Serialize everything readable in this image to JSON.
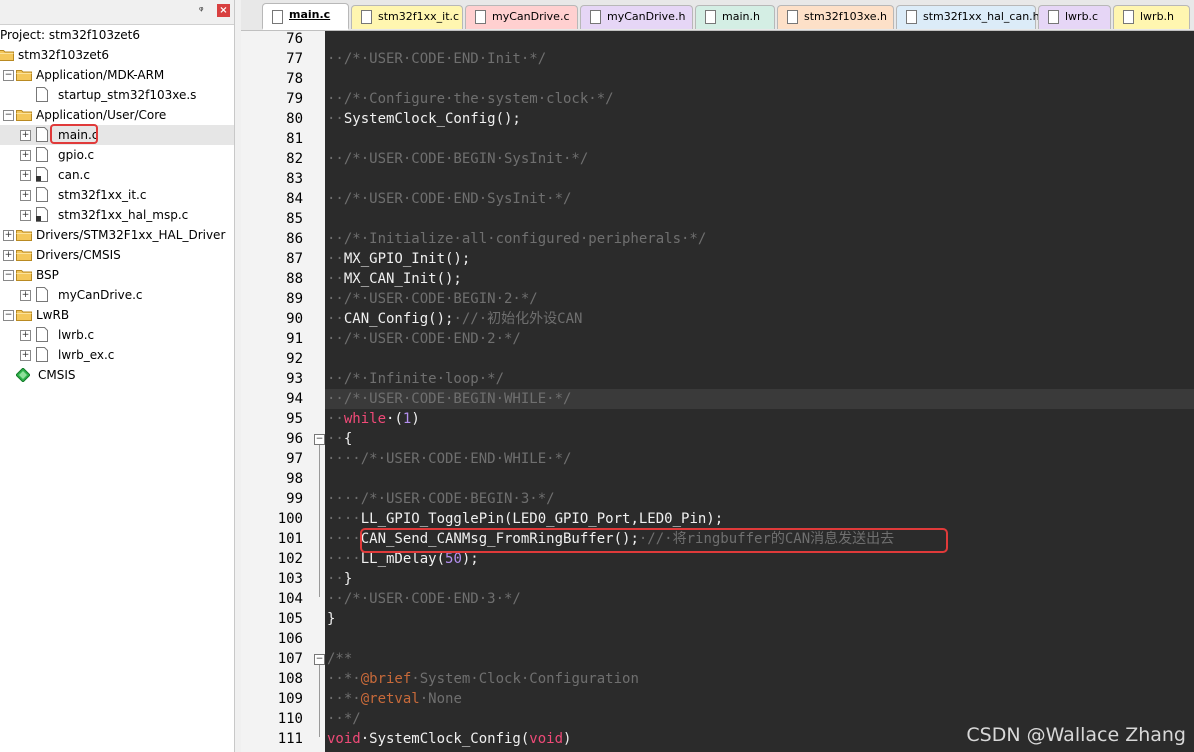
{
  "project_pane": {
    "pin_symbol": "ᵠ",
    "close_symbol": "×",
    "items": [
      {
        "label": "Project: stm32f103zet6",
        "type": "root-label",
        "level": 0
      },
      {
        "label": "stm32f103zet6",
        "type": "project",
        "level": 0
      },
      {
        "label": "Application/MDK-ARM",
        "type": "folder",
        "level": 1,
        "expander": "−"
      },
      {
        "label": "startup_stm32f103xe.s",
        "type": "file",
        "level": 2
      },
      {
        "label": "Application/User/Core",
        "type": "folder",
        "level": 1,
        "expander": "−"
      },
      {
        "label": "main.c",
        "type": "file",
        "level": 2,
        "expander": "+",
        "selected": true
      },
      {
        "label": "gpio.c",
        "type": "file",
        "level": 2,
        "expander": "+"
      },
      {
        "label": "can.c",
        "type": "file-lock",
        "level": 2,
        "expander": "+"
      },
      {
        "label": "stm32f1xx_it.c",
        "type": "file",
        "level": 2,
        "expander": "+"
      },
      {
        "label": "stm32f1xx_hal_msp.c",
        "type": "file-lock",
        "level": 2,
        "expander": "+"
      },
      {
        "label": "Drivers/STM32F1xx_HAL_Driver",
        "type": "folder",
        "level": 1,
        "expander": "+"
      },
      {
        "label": "Drivers/CMSIS",
        "type": "folder",
        "level": 1,
        "expander": "+"
      },
      {
        "label": "BSP",
        "type": "folder",
        "level": 1,
        "expander": "−"
      },
      {
        "label": "myCanDrive.c",
        "type": "file",
        "level": 2,
        "expander": "+"
      },
      {
        "label": "LwRB",
        "type": "folder",
        "level": 1,
        "expander": "−"
      },
      {
        "label": "lwrb.c",
        "type": "file",
        "level": 2,
        "expander": "+"
      },
      {
        "label": "lwrb_ex.c",
        "type": "file",
        "level": 2,
        "expander": "+"
      },
      {
        "label": "CMSIS",
        "type": "component",
        "level": 1
      }
    ]
  },
  "tabs": [
    {
      "label": "main.c",
      "color": "#ffffff",
      "active": true
    },
    {
      "label": "stm32f1xx_it.c",
      "color": "#fff6b0"
    },
    {
      "label": "myCanDrive.c",
      "color": "#ffd0d0"
    },
    {
      "label": "myCanDrive.h",
      "color": "#e6d6f6"
    },
    {
      "label": "main.h",
      "color": "#d4eee4"
    },
    {
      "label": "stm32f103xe.h",
      "color": "#fde0c8"
    },
    {
      "label": "stm32f1xx_hal_can.h",
      "color": "#dcecf8"
    },
    {
      "label": "lwrb.c",
      "color": "#e6d6f6"
    },
    {
      "label": "lwrb.h",
      "color": "#fff6b0"
    }
  ],
  "editor": {
    "lines": [
      {
        "n": "76",
        "segs": [
          [
            "code",
            ""
          ]
        ]
      },
      {
        "n": "77",
        "segs": [
          [
            "comment",
            "··/*·USER·CODE·END·Init·*/"
          ]
        ]
      },
      {
        "n": "78",
        "segs": [
          [
            "code",
            ""
          ]
        ]
      },
      {
        "n": "79",
        "segs": [
          [
            "comment",
            "··/*·Configure·the·system·clock·*/"
          ]
        ]
      },
      {
        "n": "80",
        "segs": [
          [
            "comment",
            "··"
          ],
          [
            "code",
            "SystemClock_Config();"
          ]
        ]
      },
      {
        "n": "81",
        "segs": [
          [
            "code",
            ""
          ]
        ]
      },
      {
        "n": "82",
        "segs": [
          [
            "comment",
            "··/*·USER·CODE·BEGIN·SysInit·*/"
          ]
        ]
      },
      {
        "n": "83",
        "segs": [
          [
            "code",
            ""
          ]
        ]
      },
      {
        "n": "84",
        "segs": [
          [
            "comment",
            "··/*·USER·CODE·END·SysInit·*/"
          ]
        ]
      },
      {
        "n": "85",
        "segs": [
          [
            "code",
            ""
          ]
        ]
      },
      {
        "n": "86",
        "segs": [
          [
            "comment",
            "··/*·Initialize·all·configured·peripherals·*/"
          ]
        ]
      },
      {
        "n": "87",
        "segs": [
          [
            "comment",
            "··"
          ],
          [
            "code",
            "MX_GPIO_Init();"
          ]
        ]
      },
      {
        "n": "88",
        "segs": [
          [
            "comment",
            "··"
          ],
          [
            "code",
            "MX_CAN_Init();"
          ]
        ]
      },
      {
        "n": "89",
        "segs": [
          [
            "comment",
            "··/*·USER·CODE·BEGIN·2·*/"
          ]
        ]
      },
      {
        "n": "90",
        "segs": [
          [
            "comment",
            "··"
          ],
          [
            "code",
            "CAN_Config();"
          ],
          [
            "comment",
            "·//·初始化外设CAN"
          ]
        ]
      },
      {
        "n": "91",
        "segs": [
          [
            "comment",
            "··/*·USER·CODE·END·2·*/"
          ]
        ]
      },
      {
        "n": "92",
        "segs": [
          [
            "code",
            ""
          ]
        ]
      },
      {
        "n": "93",
        "segs": [
          [
            "comment",
            "··/*·Infinite·loop·*/"
          ]
        ]
      },
      {
        "n": "94",
        "segs": [
          [
            "comment",
            "··/*·USER·CODE·BEGIN·WHILE·*/"
          ]
        ],
        "hl": true
      },
      {
        "n": "95",
        "segs": [
          [
            "comment",
            "··"
          ],
          [
            "keyword",
            "while"
          ],
          [
            "code",
            "·("
          ],
          [
            "num",
            "1"
          ],
          [
            "code",
            ")"
          ]
        ]
      },
      {
        "n": "96",
        "segs": [
          [
            "comment",
            "··"
          ],
          [
            "code",
            "{"
          ]
        ],
        "fold": "−"
      },
      {
        "n": "97",
        "segs": [
          [
            "comment",
            "····/*·USER·CODE·END·WHILE·*/"
          ]
        ]
      },
      {
        "n": "98",
        "segs": [
          [
            "code",
            ""
          ]
        ]
      },
      {
        "n": "99",
        "segs": [
          [
            "comment",
            "····/*·USER·CODE·BEGIN·3·*/"
          ]
        ]
      },
      {
        "n": "100",
        "segs": [
          [
            "comment",
            "····"
          ],
          [
            "code",
            "LL_GPIO_TogglePin(LED0_GPIO_Port,LED0_Pin);"
          ]
        ]
      },
      {
        "n": "101",
        "segs": [
          [
            "comment",
            "····"
          ],
          [
            "code",
            "CAN_Send_CANMsg_FromRingBuffer();"
          ],
          [
            "comment",
            "·//·将ringbuffer的CAN消息发送出去"
          ]
        ]
      },
      {
        "n": "102",
        "segs": [
          [
            "comment",
            "····"
          ],
          [
            "code",
            "LL_mDelay("
          ],
          [
            "num",
            "50"
          ],
          [
            "code",
            ");"
          ]
        ]
      },
      {
        "n": "103",
        "segs": [
          [
            "comment",
            "··"
          ],
          [
            "code",
            "}"
          ]
        ]
      },
      {
        "n": "104",
        "segs": [
          [
            "comment",
            "··/*·USER·CODE·END·3·*/"
          ]
        ]
      },
      {
        "n": "105",
        "segs": [
          [
            "code",
            "}"
          ]
        ]
      },
      {
        "n": "106",
        "segs": [
          [
            "code",
            ""
          ]
        ]
      },
      {
        "n": "107",
        "segs": [
          [
            "comment",
            "/**"
          ]
        ],
        "fold": "−"
      },
      {
        "n": "108",
        "segs": [
          [
            "comment",
            "··*·"
          ],
          [
            "tag",
            "@brief"
          ],
          [
            "comment",
            "·System·Clock·Configuration"
          ]
        ]
      },
      {
        "n": "109",
        "segs": [
          [
            "comment",
            "··*·"
          ],
          [
            "tag",
            "@retval"
          ],
          [
            "comment",
            "·None"
          ]
        ]
      },
      {
        "n": "110",
        "segs": [
          [
            "comment",
            "··*/"
          ]
        ]
      },
      {
        "n": "111",
        "segs": [
          [
            "keyword",
            "void"
          ],
          [
            "code",
            "·SystemClock_Config("
          ],
          [
            "keyword",
            "void"
          ],
          [
            "code",
            ")"
          ]
        ]
      }
    ]
  },
  "colors": {
    "editor_bg": "#2b2b2b",
    "comment": "#6f6f6f",
    "keyword": "#f04a78",
    "number": "#b490f0",
    "annotation_box": "#e03a3a"
  },
  "watermark": "CSDN @Wallace Zhang"
}
